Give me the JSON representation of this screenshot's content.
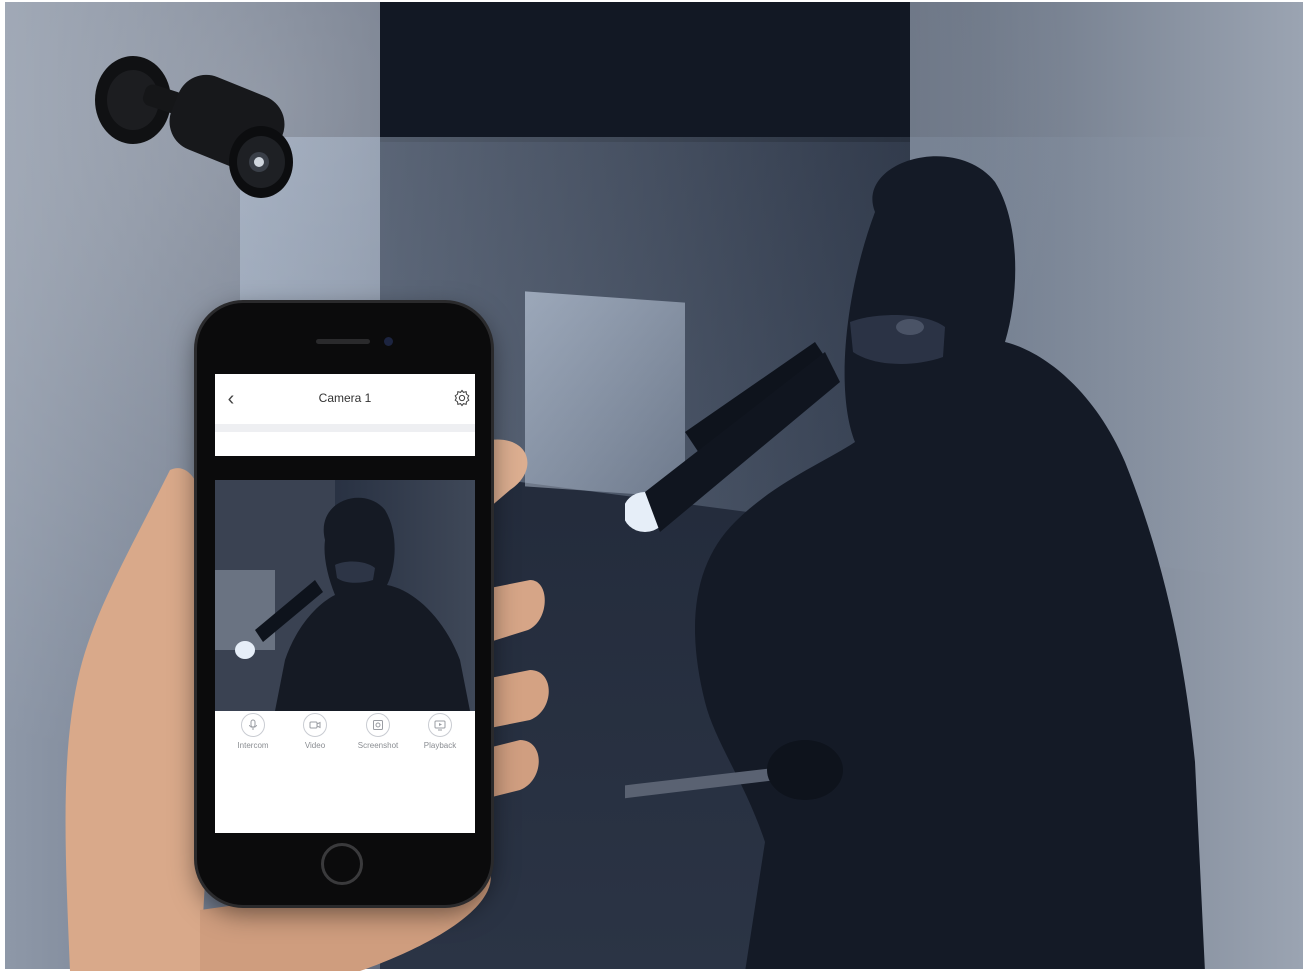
{
  "app": {
    "title": "Camera 1",
    "back_icon": "chevron-left-icon",
    "settings_icon": "gear-icon"
  },
  "controls": [
    {
      "label": "Intercom",
      "icon": "microphone-icon"
    },
    {
      "label": "Video",
      "icon": "video-camera-icon"
    },
    {
      "label": "Screenshot",
      "icon": "screenshot-icon"
    },
    {
      "label": "Playback",
      "icon": "playback-icon"
    }
  ],
  "colors": {
    "screen_bg": "#ffffff",
    "header_text": "#333333",
    "control_label": "#8a8d92",
    "phone_body": "#0b0b0c"
  }
}
